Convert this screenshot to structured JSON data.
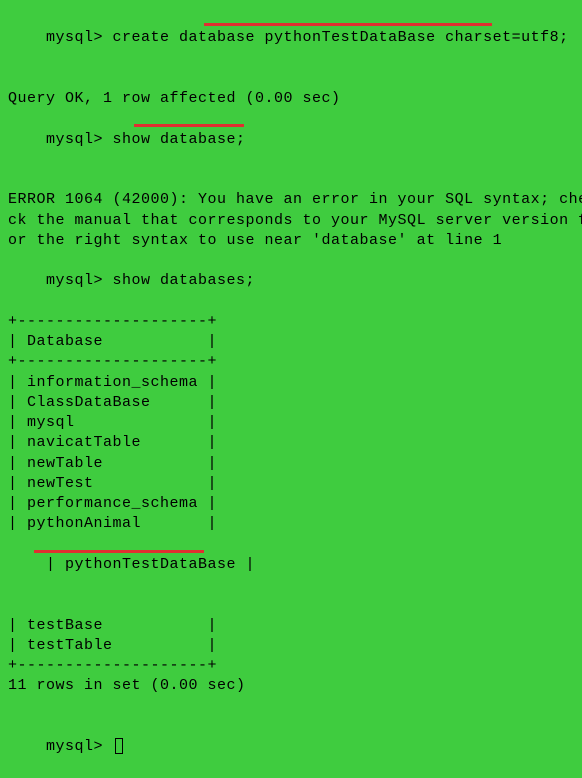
{
  "lines": {
    "l1_prompt": "mysql> ",
    "l1_cmd": "create database pythonTestDataBase charset=utf8;",
    "l2": "Query OK, 1 row affected (0.00 sec)",
    "l3": "",
    "l4_prompt": "mysql> ",
    "l4_cmd": "show database;",
    "l5": "ERROR 1064 (42000): You have an error in your SQL syntax; che",
    "l6": "ck the manual that corresponds to your MySQL server version f",
    "l7": "or the right syntax to use near 'database' at line 1",
    "l8_prompt": "mysql> ",
    "l8_cmd": "show databases;",
    "sep": "+--------------------+",
    "header": "| Database           |",
    "rows": [
      "| information_schema |",
      "| ClassDataBase      |",
      "| mysql              |",
      "| navicatTable       |",
      "| newTable           |",
      "| newTest            |",
      "| performance_schema |",
      "| pythonAnimal       |",
      "| pythonTestDataBase |",
      "| testBase           |",
      "| testTable          |"
    ],
    "footer": "11 rows in set (0.00 sec)",
    "last_prompt": "mysql> "
  }
}
